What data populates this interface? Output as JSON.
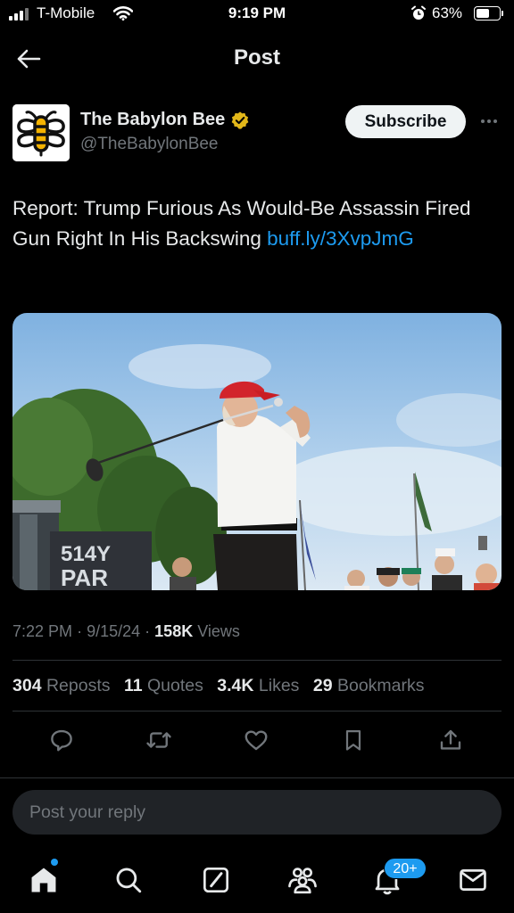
{
  "status_bar": {
    "carrier": "T-Mobile",
    "time": "9:19 PM",
    "battery_percent": "63%",
    "battery_level": 0.63,
    "icons": [
      "signal-icon",
      "wifi-icon",
      "alarm-icon",
      "battery-icon"
    ]
  },
  "header": {
    "title": "Post",
    "back_icon": "arrow-left-icon"
  },
  "post": {
    "author": {
      "name": "The Babylon Bee",
      "handle": "@TheBabylonBee",
      "verified_icon": "verified-badge-icon",
      "verified_color": "#e2b719"
    },
    "subscribe_label": "Subscribe",
    "text": "Report: Trump Furious As Would-Be Assassin Fired Gun Right In His Backswing",
    "link_text": "buff.ly/​3XvpJmG",
    "media": {
      "sign_line1": "514Y",
      "sign_line2": "PAR"
    },
    "meta": {
      "time": "7:22 PM",
      "date": "9/15/24",
      "views_count": "158K",
      "views_label": "Views"
    },
    "stats": [
      {
        "count": "304",
        "label": "Reposts"
      },
      {
        "count": "11",
        "label": "Quotes"
      },
      {
        "count": "3.4K",
        "label": "Likes"
      },
      {
        "count": "29",
        "label": "Bookmarks"
      }
    ],
    "actions": [
      "reply-icon",
      "repost-icon",
      "like-icon",
      "bookmark-icon",
      "share-icon"
    ]
  },
  "reply": {
    "placeholder": "Post your reply"
  },
  "tab_bar": {
    "items": [
      "home-icon",
      "search-icon",
      "grok-icon",
      "communities-icon",
      "notifications-icon",
      "messages-icon"
    ],
    "notification_badge": "20+"
  },
  "colors": {
    "background": "#000000",
    "text_primary": "#e7e9ea",
    "text_secondary": "#71767b",
    "accent": "#1d9bf0",
    "divider": "#2f3336"
  }
}
